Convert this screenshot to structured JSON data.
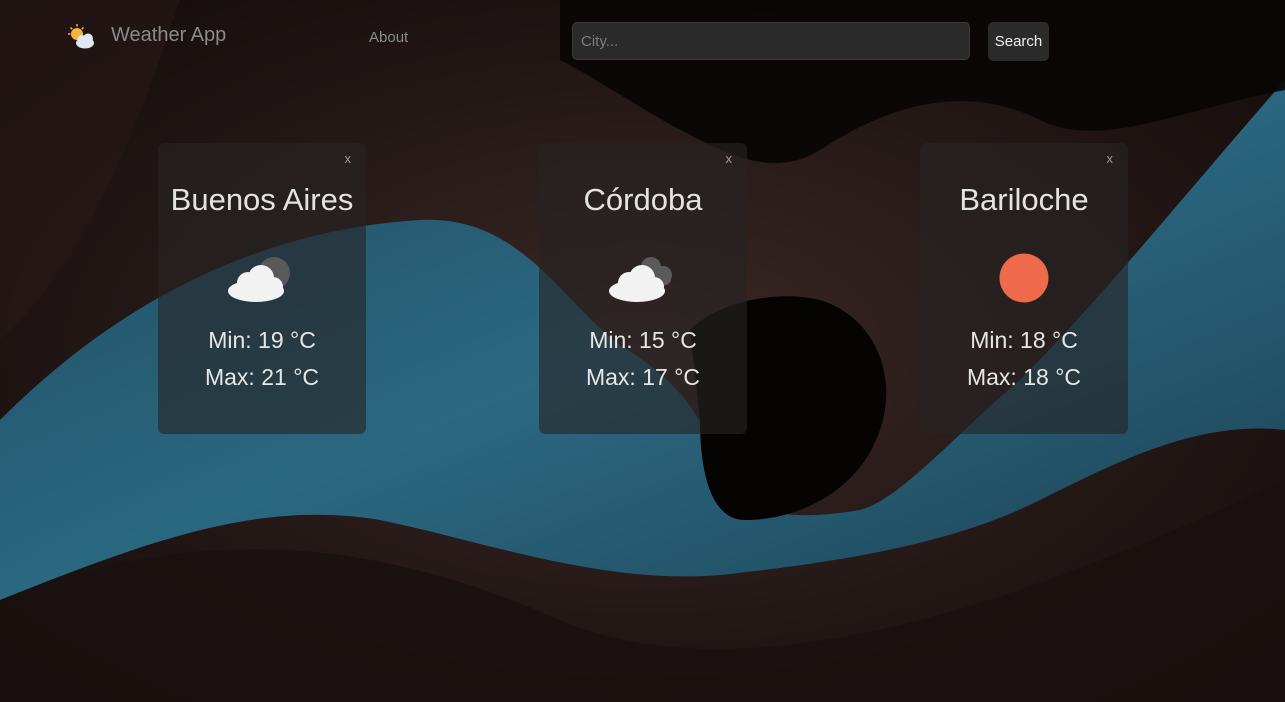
{
  "header": {
    "title": "Weather App",
    "about_label": "About",
    "search_placeholder": "City...",
    "search_value": "",
    "search_button": "Search"
  },
  "cards": [
    {
      "city": "Buenos Aires",
      "min": "Min: 19 °C",
      "max": "Max: 21 °C",
      "close": "x",
      "icon": "cloudy-icon"
    },
    {
      "city": "Córdoba",
      "min": "Min: 15 °C",
      "max": "Max: 17 °C",
      "close": "x",
      "icon": "overcast-icon"
    },
    {
      "city": "Bariloche",
      "min": "Min: 18 °C",
      "max": "Max: 18 °C",
      "close": "x",
      "icon": "sun-icon"
    }
  ],
  "colors": {
    "sun": "#ee6a4a",
    "cloud": "#f2f2f2",
    "card_bg": "#262423"
  }
}
